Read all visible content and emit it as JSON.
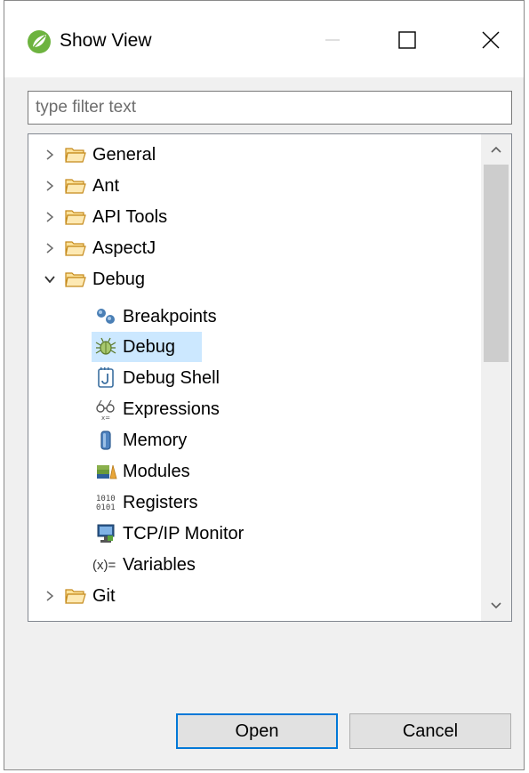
{
  "window": {
    "title": "Show View",
    "controls": {
      "minimize": "minimize",
      "maximize": "maximize",
      "close": "close"
    }
  },
  "filter": {
    "placeholder": "type filter text",
    "value": ""
  },
  "tree": {
    "categories": [
      {
        "label": "General",
        "expanded": false
      },
      {
        "label": "Ant",
        "expanded": false
      },
      {
        "label": "API Tools",
        "expanded": false
      },
      {
        "label": "AspectJ",
        "expanded": false
      },
      {
        "label": "Debug",
        "expanded": true
      },
      {
        "label": "Git",
        "expanded": false
      }
    ],
    "debug_children": [
      {
        "label": "Breakpoints",
        "icon": "breakpoints-icon"
      },
      {
        "label": "Debug",
        "icon": "debug-bug-icon",
        "selected": true
      },
      {
        "label": "Debug Shell",
        "icon": "debug-shell-icon"
      },
      {
        "label": "Expressions",
        "icon": "expressions-icon"
      },
      {
        "label": "Memory",
        "icon": "memory-icon"
      },
      {
        "label": "Modules",
        "icon": "modules-icon"
      },
      {
        "label": "Registers",
        "icon": "registers-icon"
      },
      {
        "label": "TCP/IP Monitor",
        "icon": "tcpip-monitor-icon"
      },
      {
        "label": "Variables",
        "icon": "variables-icon"
      }
    ],
    "variables_icon_text": "(x)=",
    "registers_icon_text": [
      "1010",
      "0101"
    ]
  },
  "buttons": {
    "open": "Open",
    "cancel": "Cancel"
  },
  "colors": {
    "selection": "#cce8ff",
    "default_button_border": "#0078d7",
    "folder_fill": "#fce29a",
    "folder_stroke": "#c58a1c"
  }
}
